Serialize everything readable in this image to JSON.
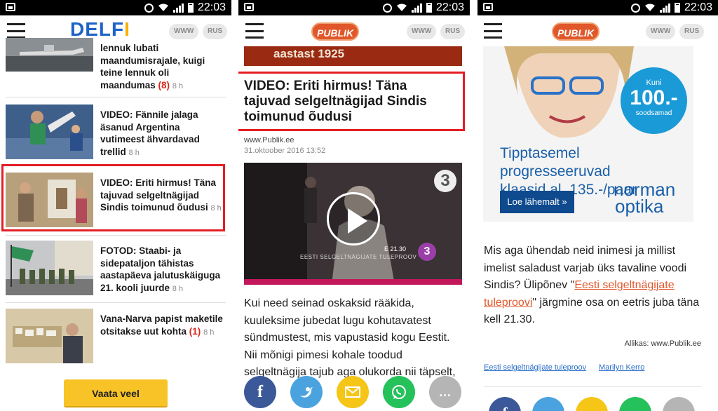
{
  "status_bar": {
    "time": "22:03"
  },
  "panel1": {
    "logo": "DELFI",
    "lang_www": "WWW",
    "lang_rus": "RUS",
    "items": [
      {
        "title": "lennuk lubati maandumisrajale, kuigi teine lennuk oli maandumas",
        "count": "(8)",
        "age": "8 h"
      },
      {
        "title": "VIDEO: Fännile jalaga äsanud Argentina vutimeest ähvardavad trellid",
        "count": "",
        "age": "8 h"
      },
      {
        "title": "VIDEO: Eriti hirmus! Täna tajuvad selgeltnägijad Sindis toimunud õudusi",
        "count": "",
        "age": "8 h"
      },
      {
        "title": "FOTOD: Staabi- ja sidepataljon tähistas aastapäeva jalutuskäiguga 21. kooli juurde",
        "count": "",
        "age": "8 h"
      },
      {
        "title": "Vana-Narva papist maketile otsitakse uut kohta",
        "count": "(1)",
        "age": "8 h"
      }
    ],
    "more_button": "Vaata veel"
  },
  "panel2": {
    "logo": "PUBLIK",
    "lang_www": "WWW",
    "lang_rus": "RUS",
    "banner_text": "aastast 1925",
    "article_title": "VIDEO: Eriti hirmus! Täna tajuvad selgeltnägijad Sindis toimunud õudusi",
    "source": "www.Publik.ee",
    "date": "31.oktoober 2016 13:52",
    "video_channel": "3",
    "video_time": "E 21.30",
    "video_caption": "EESTI SELGELTNÄGIJATE TULEPROOV",
    "body_lines": [
      "Kui need seinad oskaksid rääkida,",
      "kuuleksime jubedat lugu kohutavatest",
      "sündmustest, mis vapustasid kogu Eestit.",
      "Nii mõnigi pimesi kohale toodud",
      "selgeltnägija tajub aga olukorda nii täpselt,"
    ]
  },
  "panel3": {
    "logo": "PUBLIK",
    "lang_www": "WWW",
    "lang_rus": "RUS",
    "ad": {
      "badge_top": "Kuni",
      "badge_price": "100.-",
      "badge_bottom": "soodsamad",
      "headline_1": "Tipptasemel progresseeruvad",
      "headline_2": "klaasid al. 135.-/paar",
      "cta": "Loe lähemalt »",
      "brand_1": "norman",
      "brand_2": "optika"
    },
    "body_before": "Mis aga ühendab neid inimesi ja millist imelist saladust varjab üks tavaline voodi Sindis? Ülipõnev \"",
    "body_link": "Eesti selgeltnägijate tuleproovi",
    "body_after": "\" järgmine osa on eetris juba täna kell 21.30.",
    "source_line": "Allikas: www.Publik.ee",
    "tags": [
      "Eesti selgeltnägijate tuleproov",
      "Marilyn Kerro"
    ]
  },
  "colors": {
    "highlight": "#e31e24",
    "facebook": "#3b5998",
    "twitter": "#4aa3df",
    "email": "#f5c518",
    "whatsapp": "#25c15b",
    "more": "#b5b5b5",
    "link": "#e0572a"
  },
  "icons": [
    "image-icon",
    "alarm-icon",
    "wifi-icon",
    "signal-icon",
    "battery-icon",
    "menu-icon",
    "play-icon",
    "facebook-icon",
    "twitter-icon",
    "email-icon",
    "whatsapp-icon",
    "more-icon"
  ]
}
